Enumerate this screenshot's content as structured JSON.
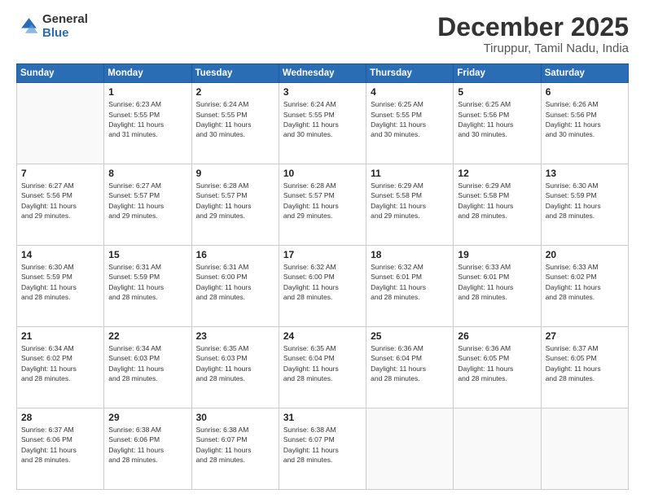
{
  "logo": {
    "general": "General",
    "blue": "Blue"
  },
  "header": {
    "month": "December 2025",
    "location": "Tiruppur, Tamil Nadu, India"
  },
  "weekdays": [
    "Sunday",
    "Monday",
    "Tuesday",
    "Wednesday",
    "Thursday",
    "Friday",
    "Saturday"
  ],
  "weeks": [
    [
      {
        "day": "",
        "info": ""
      },
      {
        "day": "1",
        "info": "Sunrise: 6:23 AM\nSunset: 5:55 PM\nDaylight: 11 hours\nand 31 minutes."
      },
      {
        "day": "2",
        "info": "Sunrise: 6:24 AM\nSunset: 5:55 PM\nDaylight: 11 hours\nand 30 minutes."
      },
      {
        "day": "3",
        "info": "Sunrise: 6:24 AM\nSunset: 5:55 PM\nDaylight: 11 hours\nand 30 minutes."
      },
      {
        "day": "4",
        "info": "Sunrise: 6:25 AM\nSunset: 5:55 PM\nDaylight: 11 hours\nand 30 minutes."
      },
      {
        "day": "5",
        "info": "Sunrise: 6:25 AM\nSunset: 5:56 PM\nDaylight: 11 hours\nand 30 minutes."
      },
      {
        "day": "6",
        "info": "Sunrise: 6:26 AM\nSunset: 5:56 PM\nDaylight: 11 hours\nand 30 minutes."
      }
    ],
    [
      {
        "day": "7",
        "info": "Sunrise: 6:27 AM\nSunset: 5:56 PM\nDaylight: 11 hours\nand 29 minutes."
      },
      {
        "day": "8",
        "info": "Sunrise: 6:27 AM\nSunset: 5:57 PM\nDaylight: 11 hours\nand 29 minutes."
      },
      {
        "day": "9",
        "info": "Sunrise: 6:28 AM\nSunset: 5:57 PM\nDaylight: 11 hours\nand 29 minutes."
      },
      {
        "day": "10",
        "info": "Sunrise: 6:28 AM\nSunset: 5:57 PM\nDaylight: 11 hours\nand 29 minutes."
      },
      {
        "day": "11",
        "info": "Sunrise: 6:29 AM\nSunset: 5:58 PM\nDaylight: 11 hours\nand 29 minutes."
      },
      {
        "day": "12",
        "info": "Sunrise: 6:29 AM\nSunset: 5:58 PM\nDaylight: 11 hours\nand 28 minutes."
      },
      {
        "day": "13",
        "info": "Sunrise: 6:30 AM\nSunset: 5:59 PM\nDaylight: 11 hours\nand 28 minutes."
      }
    ],
    [
      {
        "day": "14",
        "info": "Sunrise: 6:30 AM\nSunset: 5:59 PM\nDaylight: 11 hours\nand 28 minutes."
      },
      {
        "day": "15",
        "info": "Sunrise: 6:31 AM\nSunset: 5:59 PM\nDaylight: 11 hours\nand 28 minutes."
      },
      {
        "day": "16",
        "info": "Sunrise: 6:31 AM\nSunset: 6:00 PM\nDaylight: 11 hours\nand 28 minutes."
      },
      {
        "day": "17",
        "info": "Sunrise: 6:32 AM\nSunset: 6:00 PM\nDaylight: 11 hours\nand 28 minutes."
      },
      {
        "day": "18",
        "info": "Sunrise: 6:32 AM\nSunset: 6:01 PM\nDaylight: 11 hours\nand 28 minutes."
      },
      {
        "day": "19",
        "info": "Sunrise: 6:33 AM\nSunset: 6:01 PM\nDaylight: 11 hours\nand 28 minutes."
      },
      {
        "day": "20",
        "info": "Sunrise: 6:33 AM\nSunset: 6:02 PM\nDaylight: 11 hours\nand 28 minutes."
      }
    ],
    [
      {
        "day": "21",
        "info": "Sunrise: 6:34 AM\nSunset: 6:02 PM\nDaylight: 11 hours\nand 28 minutes."
      },
      {
        "day": "22",
        "info": "Sunrise: 6:34 AM\nSunset: 6:03 PM\nDaylight: 11 hours\nand 28 minutes."
      },
      {
        "day": "23",
        "info": "Sunrise: 6:35 AM\nSunset: 6:03 PM\nDaylight: 11 hours\nand 28 minutes."
      },
      {
        "day": "24",
        "info": "Sunrise: 6:35 AM\nSunset: 6:04 PM\nDaylight: 11 hours\nand 28 minutes."
      },
      {
        "day": "25",
        "info": "Sunrise: 6:36 AM\nSunset: 6:04 PM\nDaylight: 11 hours\nand 28 minutes."
      },
      {
        "day": "26",
        "info": "Sunrise: 6:36 AM\nSunset: 6:05 PM\nDaylight: 11 hours\nand 28 minutes."
      },
      {
        "day": "27",
        "info": "Sunrise: 6:37 AM\nSunset: 6:05 PM\nDaylight: 11 hours\nand 28 minutes."
      }
    ],
    [
      {
        "day": "28",
        "info": "Sunrise: 6:37 AM\nSunset: 6:06 PM\nDaylight: 11 hours\nand 28 minutes."
      },
      {
        "day": "29",
        "info": "Sunrise: 6:38 AM\nSunset: 6:06 PM\nDaylight: 11 hours\nand 28 minutes."
      },
      {
        "day": "30",
        "info": "Sunrise: 6:38 AM\nSunset: 6:07 PM\nDaylight: 11 hours\nand 28 minutes."
      },
      {
        "day": "31",
        "info": "Sunrise: 6:38 AM\nSunset: 6:07 PM\nDaylight: 11 hours\nand 28 minutes."
      },
      {
        "day": "",
        "info": ""
      },
      {
        "day": "",
        "info": ""
      },
      {
        "day": "",
        "info": ""
      }
    ]
  ]
}
